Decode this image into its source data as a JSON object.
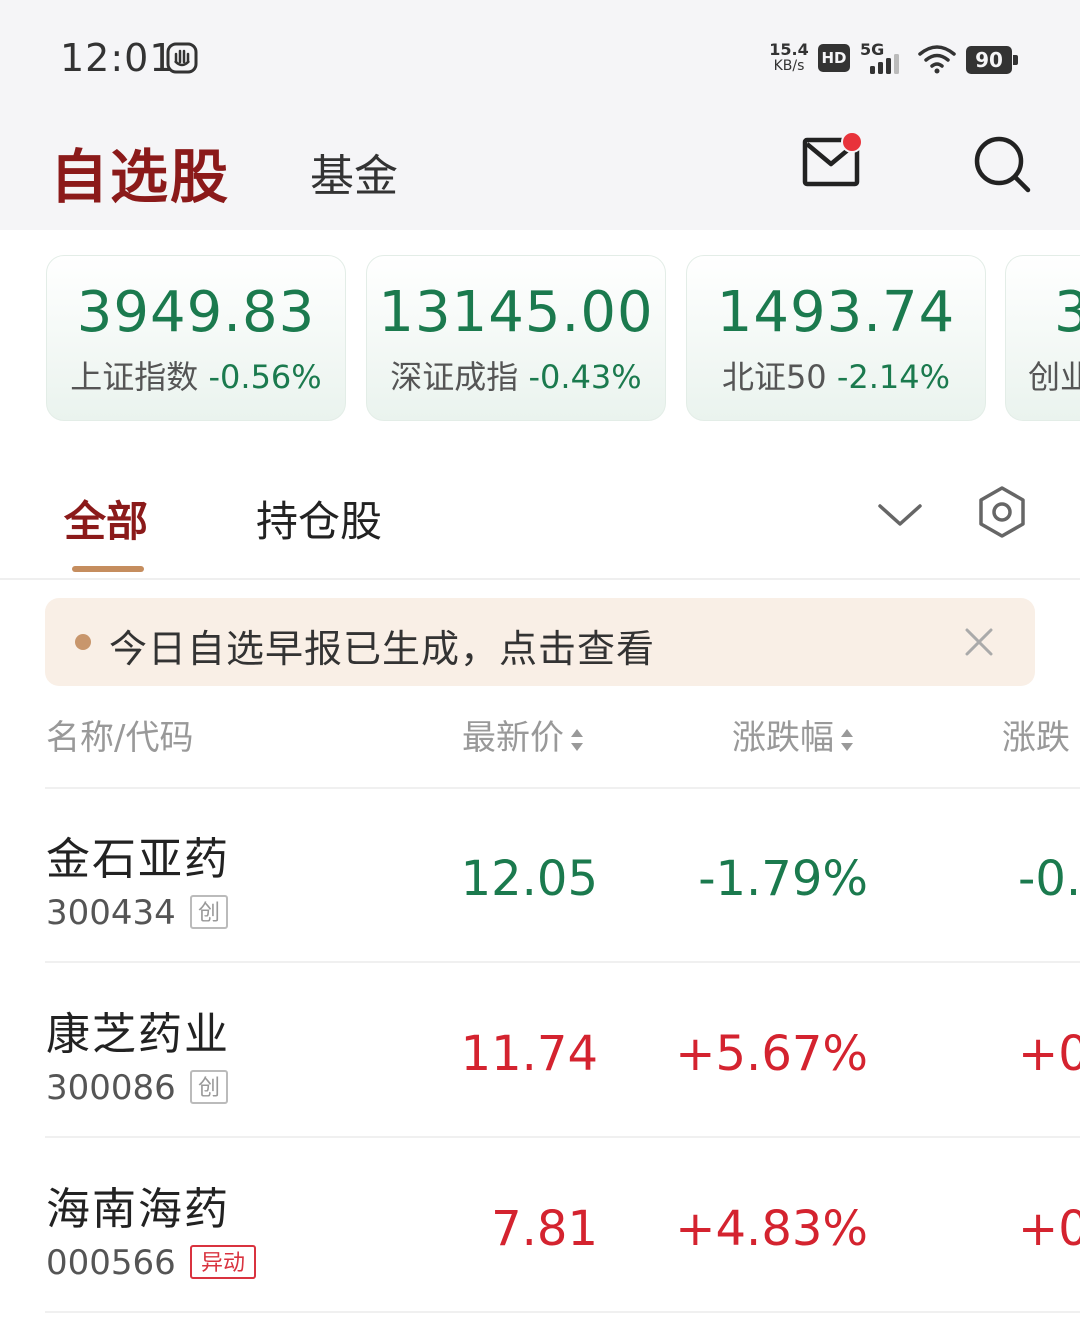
{
  "status": {
    "time": "12:01",
    "speed_top": "15.4",
    "speed_bottom": "KB/s",
    "hd": "HD",
    "network": "5G",
    "battery": "90"
  },
  "header": {
    "title": "自选股",
    "fund_tab": "基金"
  },
  "indices": [
    {
      "value": "3949.83",
      "name": "上证指数",
      "pct": "-0.56%"
    },
    {
      "value": "13145.00",
      "name": "深证成指",
      "pct": "-0.43%"
    },
    {
      "value": "1493.74",
      "name": "北证50",
      "pct": "-2.14%"
    },
    {
      "value": "3",
      "name": "创业",
      "pct": ""
    }
  ],
  "tabs": {
    "all": "全部",
    "holdings": "持仓股"
  },
  "banner": {
    "text": "今日自选早报已生成，点击查看"
  },
  "columns": {
    "name": "名称/代码",
    "price": "最新价",
    "pct": "涨跌幅",
    "change": "涨跌"
  },
  "stocks": [
    {
      "name": "金石亚药",
      "code": "300434",
      "tag": "创",
      "price": "12.05",
      "pct": "-1.79%",
      "change": "-0.",
      "direction": "down"
    },
    {
      "name": "康芝药业",
      "code": "300086",
      "tag": "创",
      "price": "11.74",
      "pct": "+5.67%",
      "change": "+0.",
      "direction": "up"
    },
    {
      "name": "海南海药",
      "code": "000566",
      "tag": "异动",
      "price": "7.81",
      "pct": "+4.83%",
      "change": "+0.",
      "direction": "up"
    }
  ],
  "colors": {
    "brand": "#8b1a1a",
    "down": "#1b7a4e",
    "up": "#d4232f",
    "accent": "#c58d5e"
  }
}
